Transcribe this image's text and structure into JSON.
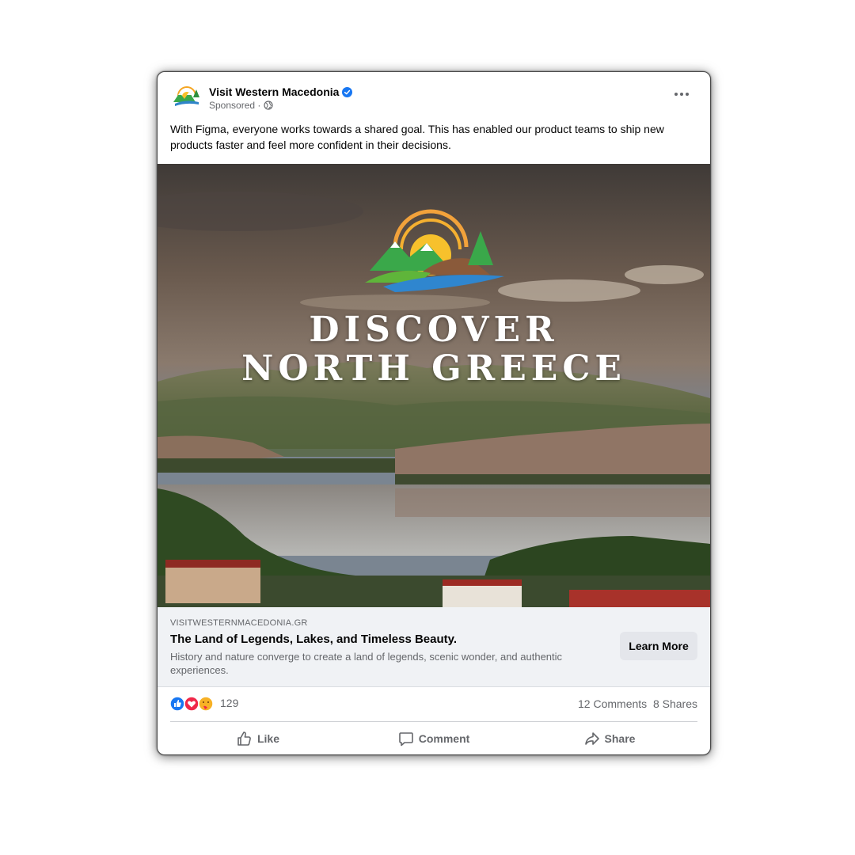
{
  "post": {
    "page_name": "Visit Western Macedonia",
    "sponsored": "Sponsored ·",
    "text": "With Figma, everyone works towards a shared goal. This has enabled our product teams to ship new products faster and feel more confident in their decisions.",
    "more_icon": "more-options-icon",
    "verified_icon": "verified-badge-icon"
  },
  "media": {
    "headline_line1": "DISCOVER",
    "headline_line2": "NORTH GREECE",
    "logo_icon": "mountain-sun-lake-logo"
  },
  "link": {
    "domain": "VISITWESTERNMACEDONIA.GR",
    "title": "The Land of Legends, Lakes, and Timeless Beauty.",
    "description": "History and nature converge to create a land of legends, scenic wonder, and authentic experiences.",
    "cta_label": "Learn More"
  },
  "stats": {
    "reaction_count": "129",
    "comments": "12 Comments",
    "shares": "8 Shares"
  },
  "actions": {
    "like": "Like",
    "comment": "Comment",
    "share": "Share"
  },
  "colors": {
    "accent_blue": "#1877f2",
    "text_primary": "#050505",
    "text_secondary": "#65676b",
    "link_bg": "#f0f2f5"
  }
}
